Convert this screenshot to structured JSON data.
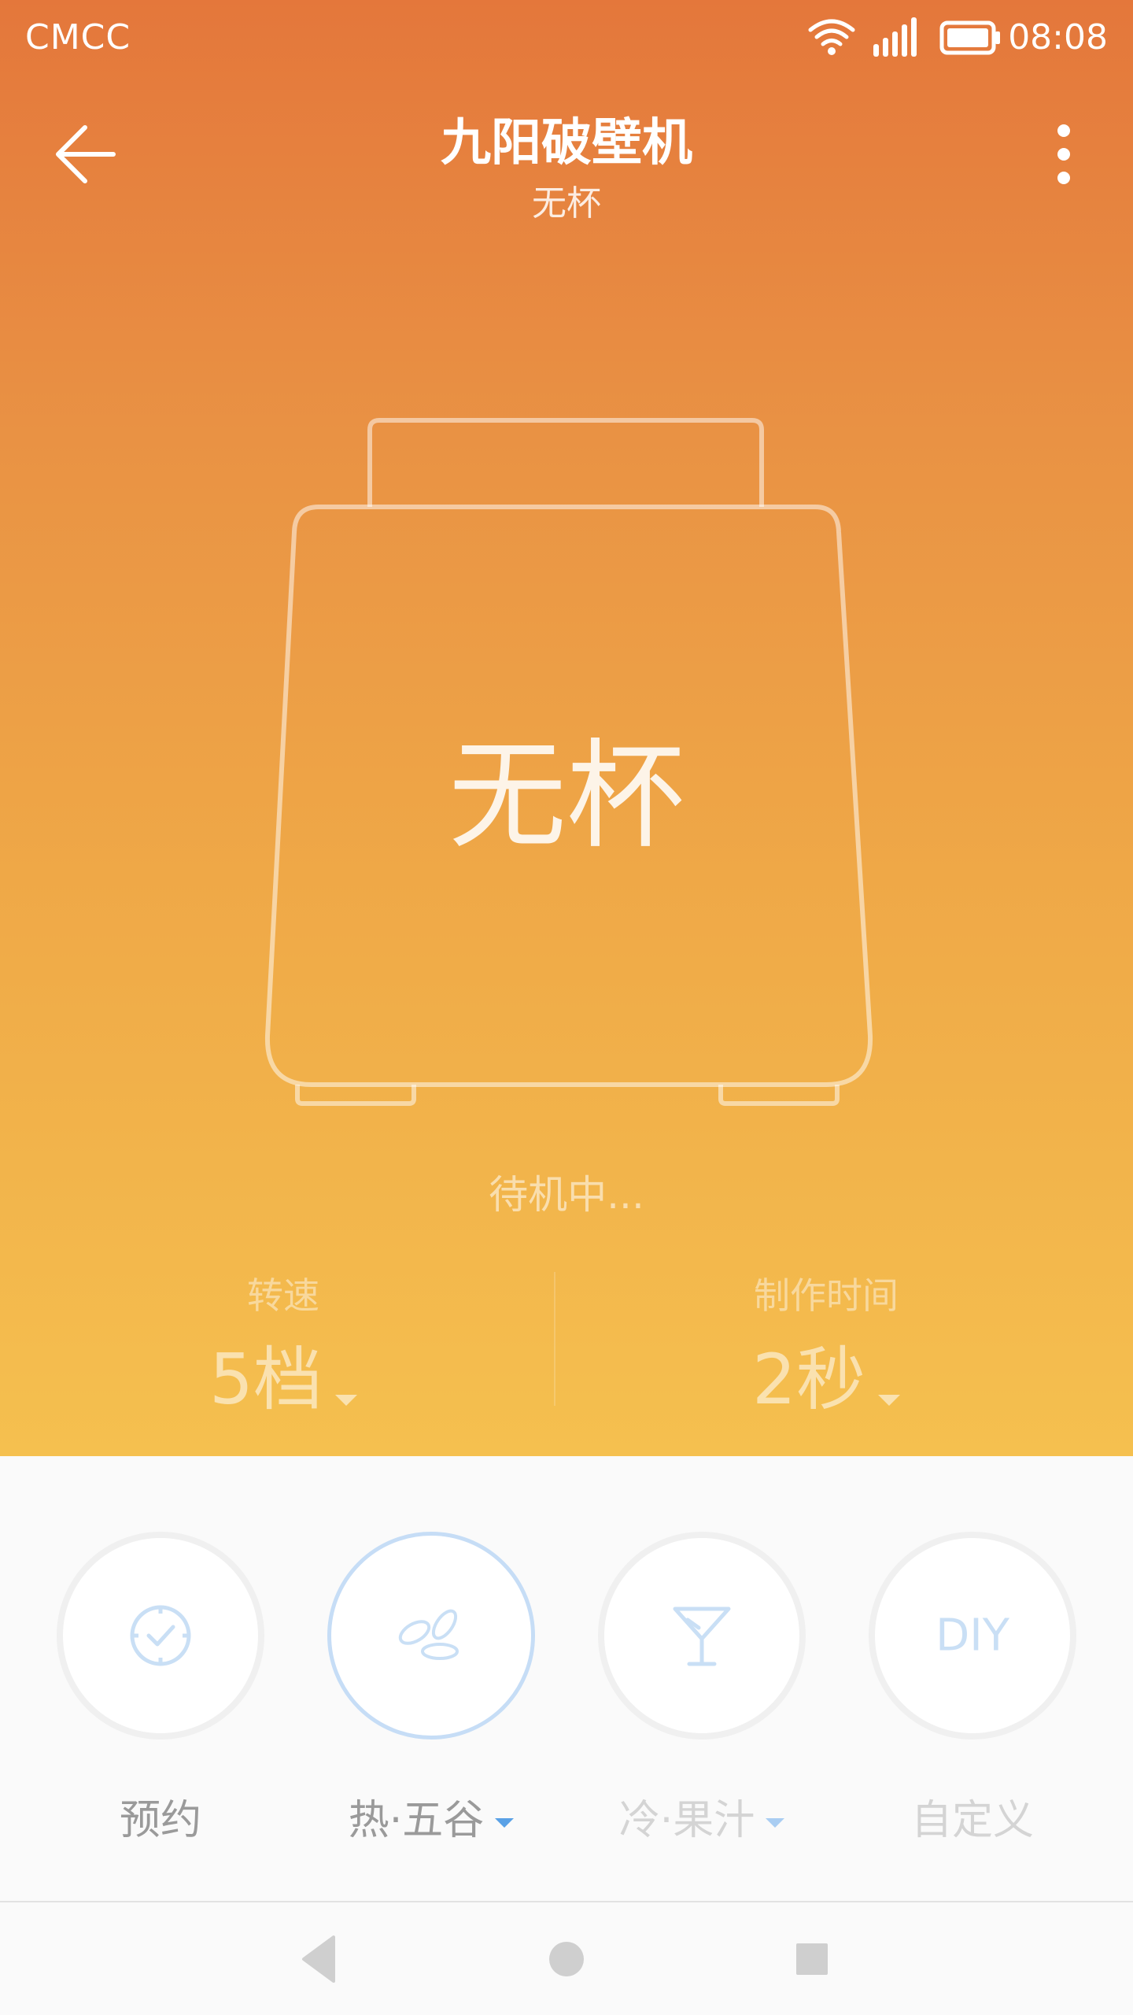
{
  "status_bar": {
    "carrier": "CMCC",
    "time": "08:08"
  },
  "header": {
    "title": "九阳破壁机",
    "subtitle": "无杯"
  },
  "device": {
    "cup_status": "无杯",
    "state": "待机中..."
  },
  "params": {
    "speed": {
      "label": "转速",
      "value": "5档"
    },
    "time": {
      "label": "制作时间",
      "value": "2秒"
    }
  },
  "modes": [
    {
      "label": "预约",
      "icon": "clock-check-icon"
    },
    {
      "label": "热·五谷",
      "icon": "grain-icon"
    },
    {
      "label": "冷·果汁",
      "icon": "cocktail-glass-icon"
    },
    {
      "label": "自定义",
      "icon_text": "DIY"
    }
  ],
  "colors": {
    "gradient_top": "#e4773b",
    "gradient_bottom": "#f5c04f",
    "accent_blue": "#5aa1e6",
    "active_ring": "#c6ddf6"
  }
}
